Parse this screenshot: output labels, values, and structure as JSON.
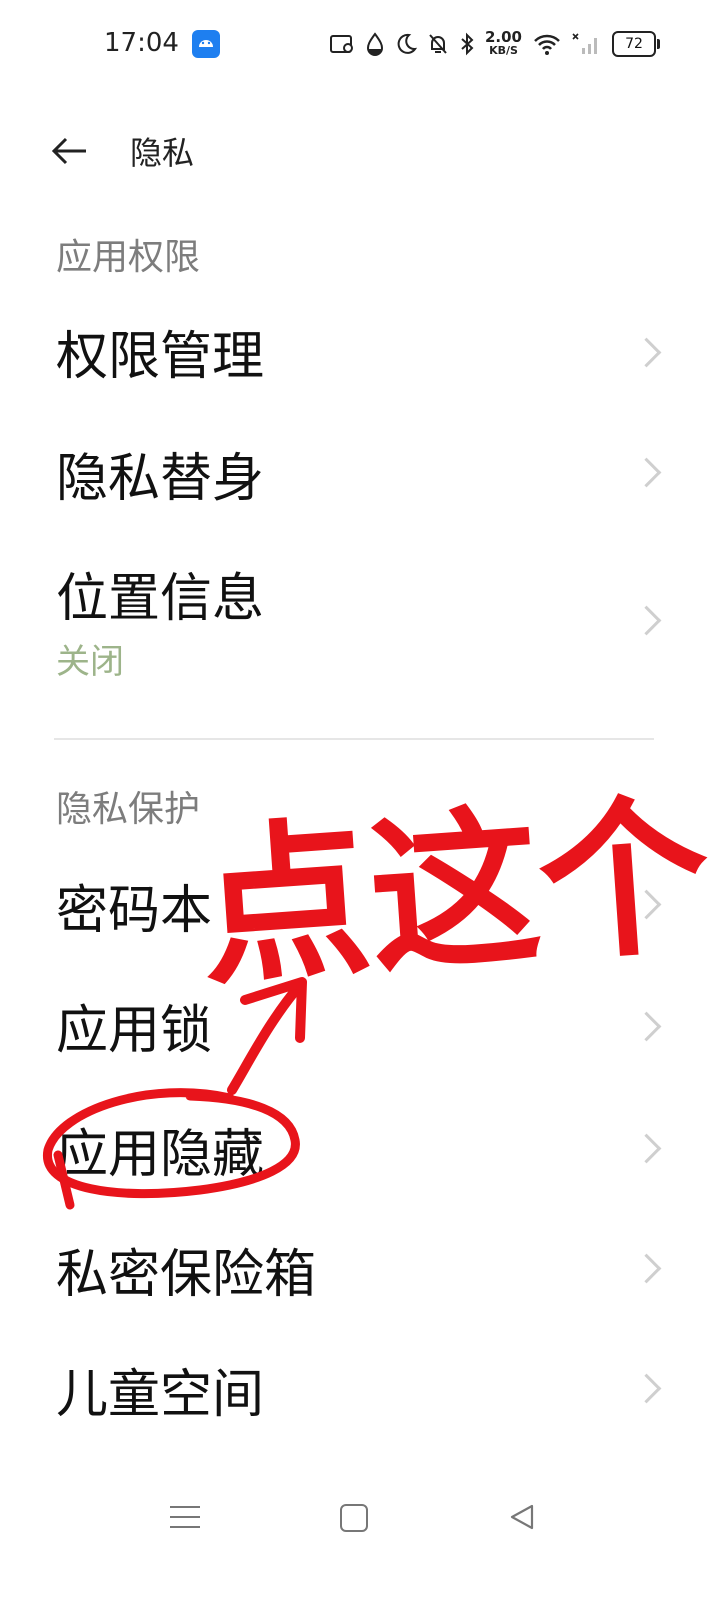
{
  "status_bar": {
    "time": "17:04",
    "net_speed_value": "2.00",
    "net_speed_unit": "KB/S",
    "battery": "72",
    "icons": [
      "android-app-icon",
      "screenshot-icon",
      "drop-icon",
      "moon-icon",
      "bell-off-icon",
      "bluetooth-icon",
      "wifi-icon",
      "signal-icon",
      "battery-icon"
    ]
  },
  "header": {
    "title": "隐私",
    "back_icon": "back-arrow-icon"
  },
  "section_app_permissions": {
    "title": "应用权限",
    "items": [
      {
        "label": "权限管理"
      },
      {
        "label": "隐私替身"
      },
      {
        "label": "位置信息",
        "sub": "关闭"
      }
    ]
  },
  "section_privacy_protection": {
    "title": "隐私保护",
    "items": [
      {
        "label": "密码本"
      },
      {
        "label": "应用锁"
      },
      {
        "label": "应用隐藏"
      },
      {
        "label": "私密保险箱"
      },
      {
        "label": "儿童空间"
      }
    ]
  },
  "annotation": {
    "text": "点这个",
    "color": "#e8141b"
  },
  "nav_bar": {
    "icons": [
      "menu-icon",
      "home-icon",
      "back-triangle-icon"
    ]
  }
}
